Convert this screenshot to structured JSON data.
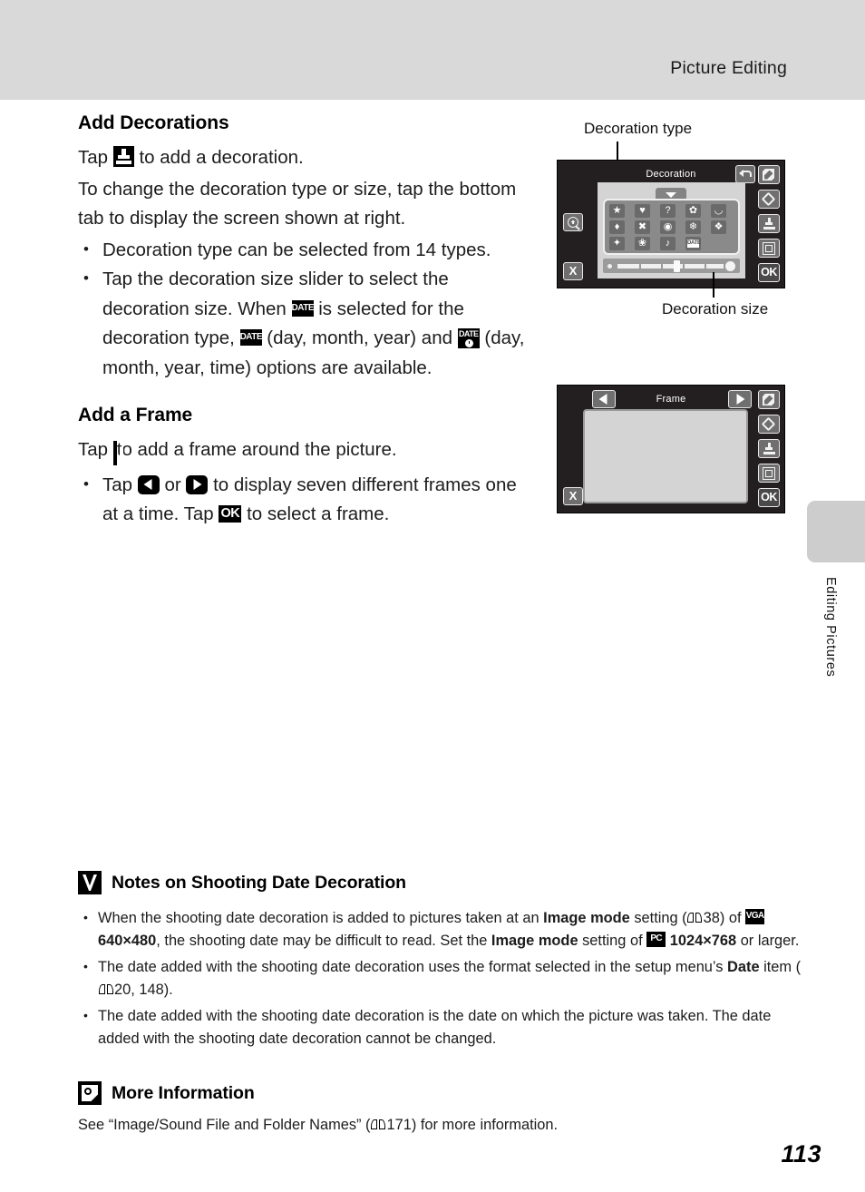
{
  "header": {
    "title": "Picture Editing"
  },
  "side_tab": {
    "label": "Editing Pictures"
  },
  "page": {
    "number": "113"
  },
  "sections": [
    {
      "heading": "Add Decorations",
      "intro_pre": "Tap",
      "intro_post": "to add a decoration.",
      "paragraph": "To change the decoration type or size, tap the bottom tab to display the screen shown at right.",
      "bullets": [
        {
          "text": "Decoration type can be selected from 14 types."
        },
        {
          "p1": "Tap the decoration size slider to select the decoration size. When",
          "p2": "is selected for the decoration type,",
          "p3": "(day, month, year) and",
          "p4": "(day, month, year, time) options are available."
        }
      ]
    },
    {
      "heading": "Add a Frame",
      "intro_pre": "Tap",
      "intro_post": "to add a frame around the picture.",
      "bullet": {
        "p1": "Tap",
        "p2": "or",
        "p3": "to display seven different frames one at a time. Tap",
        "p4": "to select a frame."
      }
    }
  ],
  "callouts": {
    "decoration_type": "Decoration type",
    "decoration_size": "Decoration size"
  },
  "screens": {
    "decoration": {
      "title": "Decoration",
      "left_buttons": [
        "magnify-icon",
        "cancel-x-icon"
      ],
      "top_buttons": [
        "undo-icon"
      ],
      "rail_icons": [
        "pencil-icon",
        "eraser-icon",
        "stamp-icon",
        "frame-icon",
        "ok-icon"
      ],
      "ok_label": "OK",
      "x_label": "X",
      "grid": [
        [
          "★",
          "♥",
          "?",
          "leaf",
          "headphones"
        ],
        [
          "droplet",
          "butterfly",
          "flower-ring",
          "ribbon",
          "exclamation"
        ],
        [
          "sparkle",
          "blossom",
          "♪",
          "DATE"
        ]
      ],
      "date_cell_label": "DATE",
      "slider": {
        "position_percent": 53
      }
    },
    "frame": {
      "title": "Frame",
      "prev_label": "left-arrow",
      "next_label": "right-arrow",
      "rail_icons": [
        "pencil-icon",
        "eraser-icon",
        "stamp-icon",
        "frame-icon",
        "ok-icon"
      ],
      "ok_label": "OK",
      "x_label": "X"
    }
  },
  "notes": {
    "caution": {
      "title": "Notes on Shooting Date Decoration",
      "items": [
        {
          "s1": "When the shooting date decoration is added to pictures taken at an ",
          "b1": "Image mode",
          "s2": " setting (",
          "ref1": "38",
          "s3": ") of ",
          "icon1": "VGA",
          "b2": "640×480",
          "s4": ", the shooting date may be difficult to read. Set the ",
          "b3": "Image mode",
          "s5": " setting of ",
          "icon2": "PC",
          "b4": "1024×768",
          "s6": " or larger."
        },
        {
          "s1": "The date added with the shooting date decoration uses the format selected in the setup menu’s ",
          "b1": "Date",
          "s2": " item (",
          "ref1": "20, 148",
          "s3": ")."
        },
        {
          "s1": "The date added with the shooting date decoration is the date on which the picture was taken. The date added with the shooting date decoration cannot be changed."
        }
      ]
    },
    "info": {
      "title": "More Information",
      "body_pre": "See “Image/Sound File and Folder Names” (",
      "ref": "171",
      "body_post": ") for more information."
    }
  }
}
